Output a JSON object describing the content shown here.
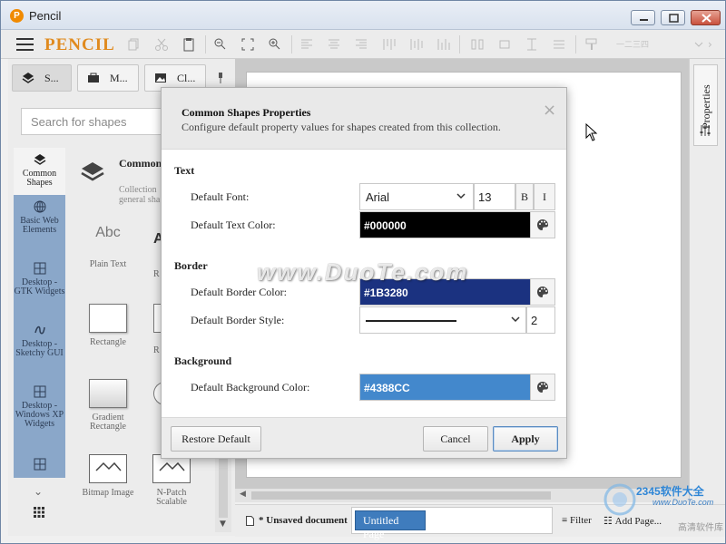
{
  "window": {
    "title": "Pencil"
  },
  "toolbar": {
    "brand": "PENCIL",
    "font_hint": "一二三四"
  },
  "left_panel": {
    "tabs": [
      {
        "label": "S...",
        "icon": "layers-icon"
      },
      {
        "label": "M...",
        "icon": "toolbox-icon"
      },
      {
        "label": "Cl...",
        "icon": "image-icon"
      }
    ],
    "search_placeholder": "Search for shapes",
    "collections": [
      {
        "label": "Common Shapes",
        "icon": "layers-icon"
      },
      {
        "label": "Basic Web Elements",
        "icon": "globe-icon"
      },
      {
        "label": "Desktop - GTK Widgets",
        "icon": "grid-icon"
      },
      {
        "label": "Desktop - Sketchy GUI",
        "icon": "squiggle-icon"
      },
      {
        "label": "Desktop - Windows XP Widgets",
        "icon": "grid-icon"
      }
    ],
    "collection_header": {
      "title": "Common Shapes",
      "desc_line1": "Collection",
      "desc_line2": "general sha"
    },
    "shapes": [
      {
        "label": "Plain Text",
        "preview": "Abc"
      },
      {
        "label": "Rectangle"
      },
      {
        "label": "Gradient Rectangle"
      },
      {
        "label": "Bitmap Image"
      },
      {
        "label": "N-Patch Scalable"
      }
    ],
    "partial_labels": {
      "r1": "R",
      "r2": "R",
      "letter": "A"
    }
  },
  "right_bar": {
    "properties_label": "Properties"
  },
  "status_bar": {
    "document_label": "* Unsaved document",
    "page_tab": "Untitled Page",
    "filter_label": "Filter",
    "add_page_label": "Add Page..."
  },
  "dialog": {
    "title": "Common Shapes Properties",
    "subtitle": "Configure default property values for shapes created from this collection.",
    "close": "×",
    "sections": {
      "text": "Text",
      "border": "Border",
      "background": "Background"
    },
    "rows": {
      "default_font": "Default Font:",
      "default_text_color": "Default Text Color:",
      "default_border_color": "Default Border Color:",
      "default_border_style": "Default Border Style:",
      "default_background_color": "Default Background Color:"
    },
    "values": {
      "font_family": "Arial",
      "font_size": "13",
      "bold": "B",
      "italic": "I",
      "text_color": "#000000",
      "border_color": "#1B3280",
      "border_width": "2",
      "background_color": "#4388CC"
    },
    "buttons": {
      "restore": "Restore Default",
      "cancel": "Cancel",
      "apply": "Apply"
    }
  },
  "watermarks": {
    "main": "www.DuoTe.com",
    "corner_cn": "2345软件大全",
    "corner_url": "www.DuoTe.com",
    "corner_cn2": "高清软件库"
  },
  "colors": {
    "brand": "#E08A1E",
    "text_color": "#000000",
    "border_color": "#1B3280",
    "background_color": "#4388CC"
  }
}
